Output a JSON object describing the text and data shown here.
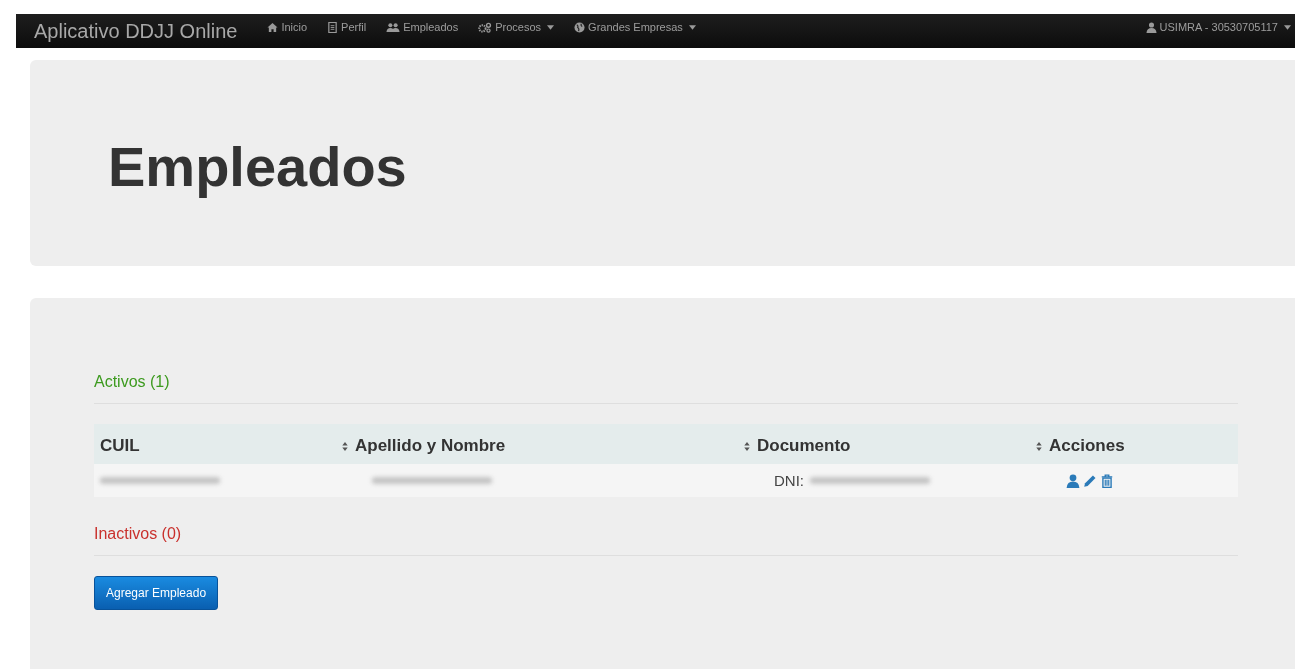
{
  "navbar": {
    "brand": "Aplicativo DDJJ Online",
    "items": [
      {
        "label": "Inicio",
        "has_menu": false
      },
      {
        "label": "Perfil",
        "has_menu": false
      },
      {
        "label": "Empleados",
        "has_menu": false
      },
      {
        "label": "Procesos",
        "has_menu": true
      },
      {
        "label": "Grandes Empresas",
        "has_menu": true
      }
    ],
    "user": {
      "label": "USIMRA - 30530705117",
      "has_menu": true
    }
  },
  "header": {
    "title": "Empleados"
  },
  "sections": [
    {
      "kind": "active",
      "title": "Activos (1)",
      "table": {
        "columns": [
          {
            "label": "CUIL",
            "sortable": false
          },
          {
            "label": "Apellido y Nombre",
            "sortable": true
          },
          {
            "label": "Documento",
            "sortable": true
          },
          {
            "label": "Acciones",
            "sortable": true
          }
        ],
        "rows": [
          {
            "cells": [
              {
                "kind": "redacted"
              },
              {
                "kind": "redacted"
              },
              {
                "kind": "redacted",
                "prefix": "DNI:"
              },
              {
                "kind": "actions"
              }
            ]
          }
        ]
      }
    },
    {
      "kind": "inactive",
      "title": "Inactivos (0)"
    }
  ],
  "add_button": {
    "label": "Agregar Empleado"
  }
}
